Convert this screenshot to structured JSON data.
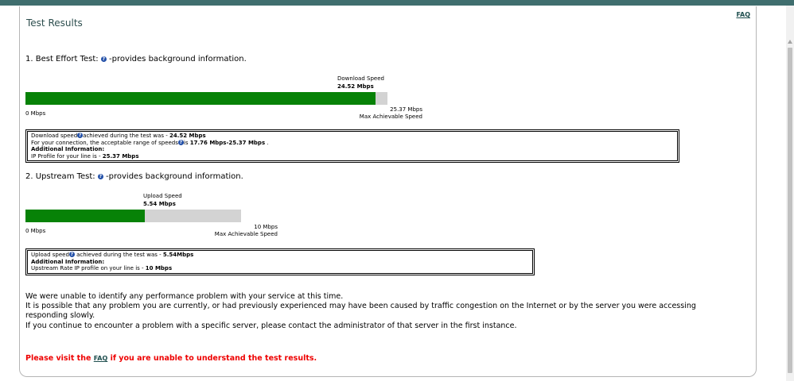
{
  "header": {
    "title": "Test Results",
    "faq_link": "FAQ"
  },
  "download": {
    "heading_prefix": "1. Best Effort Test:",
    "heading_suffix": "-provides background information.",
    "bar_title": "Download Speed",
    "speed_value": "24.52 Mbps",
    "fill_fraction": 0.9665,
    "scale_min": "0 Mbps",
    "scale_max": "25.37 Mbps",
    "scale_max_label": "Max Achievable Speed",
    "info": {
      "line1_prefix": "Download speed",
      "line1_mid": "achieved during the test was - ",
      "line1_value": "24.52 Mbps",
      "line2_prefix": "For your connection, the acceptable range of speeds",
      "line2_mid": "is ",
      "line2_value": "17.76 Mbps-25.37 Mbps",
      "line2_suffix": " .",
      "line3": "Additional Information:",
      "line4_prefix": "IP Profile for your line is - ",
      "line4_value": "25.37 Mbps"
    }
  },
  "upload": {
    "heading_prefix": "2. Upstream Test:",
    "heading_suffix": "-provides background information.",
    "bar_title": "Upload Speed",
    "speed_value": "5.54 Mbps",
    "fill_fraction": 0.554,
    "scale_min": "0 Mbps",
    "scale_max": "10 Mbps",
    "scale_max_label": "Max Achievable Speed",
    "info": {
      "line1_prefix": "Upload speed",
      "line1_mid": " achieved during the test was - ",
      "line1_value": "5.54Mbps",
      "line2": "Additional Information:",
      "line3_prefix": "Upstream Rate IP profile on your line is - ",
      "line3_value": "10 Mbps"
    }
  },
  "summary": {
    "line1": "We were unable to identify any performance problem with your service at this time.",
    "line2": "It is possible that any problem you are currently, or had previously experienced may have been caused by traffic congestion on the Internet or by the server you were accessing responding slowly.",
    "line3": "If you continue to encounter a problem with a specific server, please contact the administrator of that server in the first instance."
  },
  "footer": {
    "visit_prefix": "Please visit the ",
    "faq_link": "FAQ",
    "visit_suffix": " if you are unable to understand the test results."
  },
  "colors": {
    "bar_fill": "#078207",
    "bar_bg": "#d3d3d3",
    "alert": "#ee0000",
    "topbar": "#3f6e6e"
  },
  "icons": {
    "info": "info-circle-icon"
  }
}
